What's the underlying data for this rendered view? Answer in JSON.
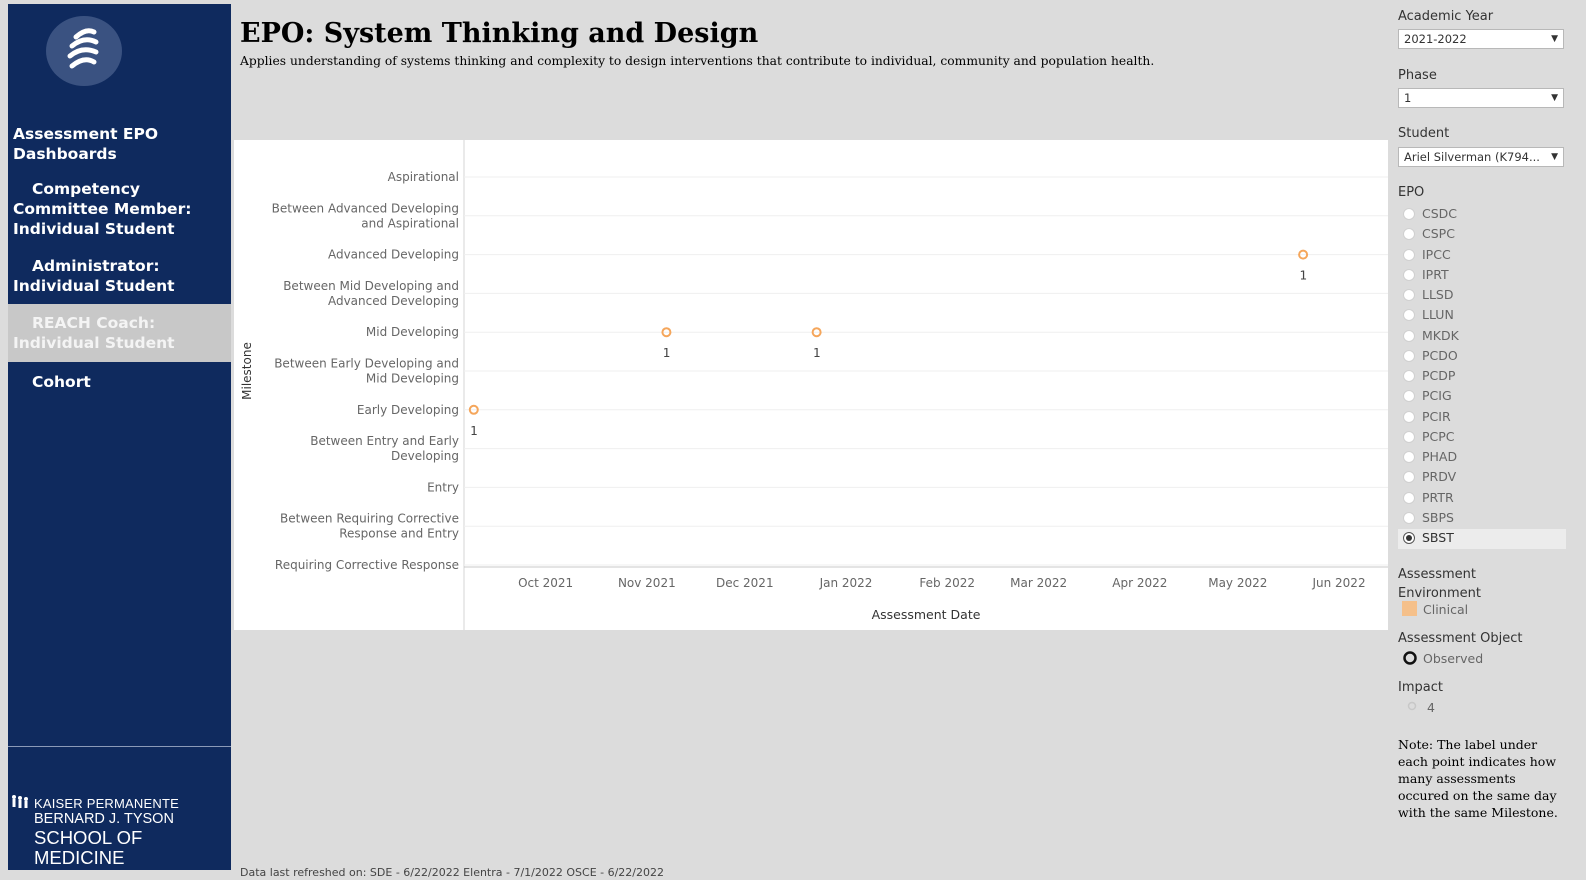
{
  "sidebar": {
    "items": [
      {
        "label": "Assessment EPO Dashboards",
        "lines": [
          "Assessment EPO",
          "Dashboards"
        ]
      },
      {
        "label": "Competency Committee Member: Individual Student",
        "lines": [
          "Competency",
          "Committee Member:",
          "Individual Student"
        ]
      },
      {
        "label": "Administrator: Individual Student",
        "lines": [
          "Administrator:",
          "Individual Student"
        ]
      },
      {
        "label": "REACH Coach: Individual Student",
        "lines": [
          "REACH Coach:",
          "Individual Student"
        ]
      },
      {
        "label": "Cohort",
        "lines": [
          "Cohort"
        ]
      }
    ],
    "brand": {
      "line1": "KAISER PERMANENTE",
      "line2": "BERNARD J. TYSON",
      "line3": "SCHOOL OF MEDICINE"
    }
  },
  "header": {
    "title": "EPO: System Thinking and Design",
    "subtitle": "Applies understanding of systems thinking and complexity to design interventions that contribute to individual, community and population health."
  },
  "filters": {
    "academic_year": {
      "label": "Academic Year",
      "value": "2021-2022"
    },
    "phase": {
      "label": "Phase",
      "value": "1"
    },
    "student": {
      "label": "Student",
      "value": "Ariel Silverman (K794..."
    },
    "epo": {
      "label": "EPO",
      "options": [
        "CSDC",
        "CSPC",
        "IPCC",
        "IPRT",
        "LLSD",
        "LLUN",
        "MKDK",
        "PCDO",
        "PCDP",
        "PCIG",
        "PCIR",
        "PCPC",
        "PHAD",
        "PRDV",
        "PRTR",
        "SBPS",
        "SBST"
      ],
      "selected": "SBST"
    },
    "assessment_environment": {
      "label_line1": "Assessment",
      "label_line2": "Environment",
      "legend_item": "Clinical",
      "color": "#f5c08a"
    },
    "assessment_object": {
      "label": "Assessment Object",
      "legend_item": "Observed"
    },
    "impact": {
      "label": "Impact",
      "legend_item": "4"
    }
  },
  "note": "Note: The label under each point indicates how many assessments occured on the same day with the same Milestone.",
  "footer": "Data last refreshed on:  SDE - 6/22/2022    Elentra - 7/1/2022    OSCE - 6/22/2022",
  "chart_data": {
    "type": "scatter",
    "xlabel": "Assessment Date",
    "ylabel": "Milestone",
    "x_ticks": [
      "Oct 2021",
      "Nov 2021",
      "Dec 2021",
      "Jan 2022",
      "Feb 2022",
      "Mar 2022",
      "Apr 2022",
      "May 2022",
      "Jun 2022"
    ],
    "xlim": [
      "2021-09-20",
      "2022-06-30"
    ],
    "categories": [
      {
        "name": "Requiring Corrective Response",
        "lines": [
          "Requiring Corrective Response"
        ]
      },
      {
        "name": "Between Requiring Corrective Response and Entry",
        "lines": [
          "Between Requiring Corrective",
          "Response and Entry"
        ]
      },
      {
        "name": "Entry",
        "lines": [
          "Entry"
        ]
      },
      {
        "name": "Between Entry and Early Developing",
        "lines": [
          "Between Entry and Early",
          "Developing"
        ]
      },
      {
        "name": "Early Developing",
        "lines": [
          "Early Developing"
        ]
      },
      {
        "name": "Between Early Developing and Mid Developing",
        "lines": [
          "Between Early Developing and",
          "Mid Developing"
        ]
      },
      {
        "name": "Mid Developing",
        "lines": [
          "Mid Developing"
        ]
      },
      {
        "name": "Between Mid Developing and Advanced Developing",
        "lines": [
          "Between Mid Developing and",
          "Advanced Developing"
        ]
      },
      {
        "name": "Advanced Developing",
        "lines": [
          "Advanced Developing"
        ]
      },
      {
        "name": "Between Advanced Developing and Aspirational",
        "lines": [
          "Between Advanced Developing",
          "and Aspirational"
        ]
      },
      {
        "name": "Aspirational",
        "lines": [
          "Aspirational"
        ]
      }
    ],
    "points": [
      {
        "x": "2021-09-23",
        "y": "Early Developing",
        "label": "1"
      },
      {
        "x": "2021-11-21",
        "y": "Mid Developing",
        "label": "1"
      },
      {
        "x": "2022-01-06",
        "y": "Mid Developing",
        "label": "1"
      },
      {
        "x": "2022-06-04",
        "y": "Advanced Developing",
        "label": "1"
      }
    ],
    "point_color": "#f5a65b",
    "grid": "horizontal"
  }
}
